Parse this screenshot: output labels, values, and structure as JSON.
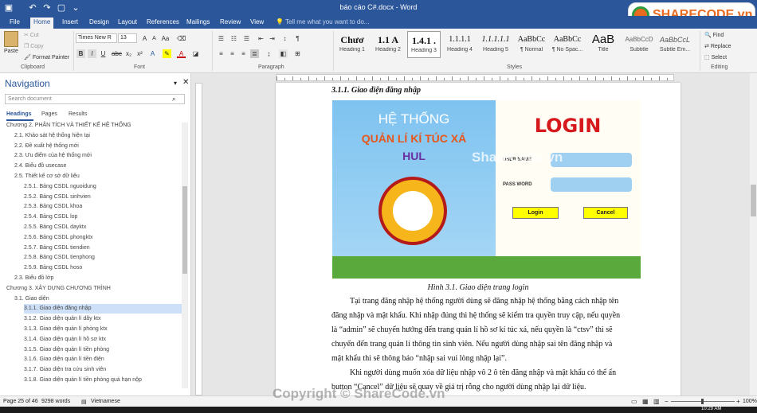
{
  "titlebar": {
    "title": "báo cáo C#.docx - Word",
    "brand": "SHARECODE.vn"
  },
  "tabs": [
    "File",
    "Home",
    "Insert",
    "Design",
    "Layout",
    "References",
    "Mailings",
    "Review",
    "View"
  ],
  "tell_me": "Tell me what you want to do...",
  "clipboard": {
    "paste": "Paste",
    "cut": "Cut",
    "copy": "Copy",
    "format_painter": "Format Painter",
    "label": "Clipboard"
  },
  "font": {
    "name": "Times New R",
    "size": "13",
    "label": "Font"
  },
  "paragraph": {
    "label": "Paragraph"
  },
  "styles": {
    "label": "Styles",
    "items": [
      {
        "preview": "Chươ",
        "name": "Heading 1"
      },
      {
        "preview": "1.1  A",
        "name": "Heading 2"
      },
      {
        "preview": "1.4.1 .",
        "name": "Heading 3"
      },
      {
        "preview": "1.1.1.1",
        "name": "Heading 4"
      },
      {
        "preview": "1.1.1.1.1",
        "name": "Heading 5"
      },
      {
        "preview": "AaBbCc",
        "name": "¶ Normal"
      },
      {
        "preview": "AaBbCc",
        "name": "¶ No Spac..."
      },
      {
        "preview": "AaB",
        "name": "Title"
      },
      {
        "preview": "AaBbCcD",
        "name": "Subtitle"
      },
      {
        "preview": "AaBbCcL",
        "name": "Subtle Em..."
      }
    ]
  },
  "editing": {
    "find": "Find",
    "replace": "Replace",
    "select": "Select",
    "label": "Editing"
  },
  "nav": {
    "title": "Navigation",
    "search_placeholder": "Search document",
    "tabs": [
      "Headings",
      "Pages",
      "Results"
    ],
    "items": [
      {
        "text": "Chương 2. PHÂN TÍCH VÀ THIẾT KẾ HỆ THỐNG",
        "level": 1
      },
      {
        "text": "2.1. Khảo sát hệ thống hiện tại",
        "level": 2
      },
      {
        "text": "2.2. Đề xuất hệ thống mới",
        "level": 2
      },
      {
        "text": "2.3. Ưu điểm của hệ thống mới",
        "level": 2
      },
      {
        "text": "2.4. Biểu đồ usecase",
        "level": 2
      },
      {
        "text": "2.5. Thiết kế cơ sở dữ liệu",
        "level": 2
      },
      {
        "text": "2.5.1. Bảng CSDL nguoidung",
        "level": 3
      },
      {
        "text": "2.5.2. Bảng CSDL sinhvien",
        "level": 3
      },
      {
        "text": "2.5.3. Bảng CSDL khoa",
        "level": 3
      },
      {
        "text": "2.5.4. Bảng CSDL lop",
        "level": 3
      },
      {
        "text": "2.5.5. Bảng CSDL dayktx",
        "level": 3
      },
      {
        "text": "2.5.6. Bảng CSDL phongktx",
        "level": 3
      },
      {
        "text": "2.5.7. Bảng CSDL tiendien",
        "level": 3
      },
      {
        "text": "2.5.8. Bảng CSDL tienphong",
        "level": 3
      },
      {
        "text": "2.5.9. Bảng CSDL hoso",
        "level": 3
      },
      {
        "text": "2.3. Biểu đồ lớp",
        "level": 2
      },
      {
        "text": "Chương 3. XÂY DỰNG CHƯƠNG TRÌNH",
        "level": 1
      },
      {
        "text": "3.1. Giao diện",
        "level": 2
      },
      {
        "text": "3.1.1. Giao diện đăng nhập",
        "level": 3,
        "selected": true
      },
      {
        "text": "3.1.2. Giao diện quản lí dãy ktx",
        "level": 3
      },
      {
        "text": "3.1.3. Giao diện quản lí phòng ktx",
        "level": 3
      },
      {
        "text": "3.1.4. Giao diện quản lí hồ sơ ktx",
        "level": 3
      },
      {
        "text": "3.1.5. Giao diện quản lí tiền phòng",
        "level": 3
      },
      {
        "text": "3.1.6. Giao diện quản lí tiền điện",
        "level": 3
      },
      {
        "text": "3.1.7. Giao diện tra cứu sinh viên",
        "level": 3
      },
      {
        "text": "3.1.8. Giao diện quản lí tiền phòng quá hạn nộp",
        "level": 3
      }
    ]
  },
  "document": {
    "heading": "3.1.1. Giao diện đăng nhập",
    "login_image": {
      "title1": "HỆ THỐNG",
      "title2": "QUẢN LÍ KÍ TÚC XÁ",
      "brand": "HUL",
      "login": "LOGIN",
      "user_label": "USER NAME",
      "pass_label": "PASS WORD",
      "login_btn": "Login",
      "cancel_btn": "Cancel",
      "watermark": "ShareCode.vn"
    },
    "caption": "Hình 3.1. Giao diện trang login",
    "para1": [
      "Tại trang đăng nhập hệ thống người dùng sẽ đăng nhập hệ thống bằng cách nhập tên",
      "đăng nhập và mật khẩu. Khi nhập đúng thì hệ thống sẽ kiểm tra quyền truy cập, nếu quyền",
      "là “admin” sẽ chuyển hướng đến trang quản lí hồ sơ kí túc xá, nếu quyền là “ctsv” thì sẽ",
      "chuyển đến trang quản lí thông tin sinh viên. Nếu người dùng nhập sai tên đăng nhập và",
      "mật khẩu thì sẽ thông báo “nhập sai vui lòng nhập lại”."
    ],
    "para2": [
      "Khi người dùng muốn xóa dữ liệu nhập vô 2 ô tên đăng nhập và mật khẩu có thể ấn",
      "button “Cancel” dữ liệu sẽ quay về giá trị rỗng cho người dùng nhập lại dữ liệu."
    ]
  },
  "status": {
    "page": "Page 25 of 46",
    "words": "9298 words",
    "language": "Vietnamese",
    "zoom": "100%",
    "copyright": "Copyright © ShareCode.vn",
    "clock": "10:29 AM"
  }
}
